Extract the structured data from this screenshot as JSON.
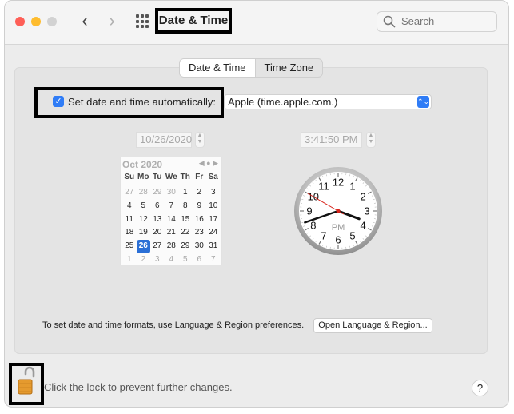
{
  "window": {
    "title": "Date & Time"
  },
  "toolbar": {
    "back": "‹",
    "forward": "›"
  },
  "search": {
    "placeholder": "Search"
  },
  "tabs": [
    {
      "label": "Date & Time",
      "active": true
    },
    {
      "label": "Time Zone",
      "active": false
    }
  ],
  "auto": {
    "label": "Set date and time automatically:",
    "checked": true
  },
  "server": {
    "value": "Apple (time.apple.com.)"
  },
  "date_field": {
    "value": "10/26/2020"
  },
  "time_field": {
    "value": "3:41:50 PM"
  },
  "calendar": {
    "month_label": "Oct 2020",
    "weekdays": [
      "Su",
      "Mo",
      "Tu",
      "We",
      "Th",
      "Fr",
      "Sa"
    ],
    "weeks": [
      [
        "27",
        "28",
        "29",
        "30",
        "1",
        "2",
        "3"
      ],
      [
        "4",
        "5",
        "6",
        "7",
        "8",
        "9",
        "10"
      ],
      [
        "11",
        "12",
        "13",
        "14",
        "15",
        "16",
        "17"
      ],
      [
        "18",
        "19",
        "20",
        "21",
        "22",
        "23",
        "24"
      ],
      [
        "25",
        "26",
        "27",
        "28",
        "29",
        "30",
        "31"
      ],
      [
        "1",
        "2",
        "3",
        "4",
        "5",
        "6",
        "7"
      ]
    ],
    "selected": "26"
  },
  "clock": {
    "numbers": [
      "12",
      "1",
      "2",
      "3",
      "4",
      "5",
      "6",
      "7",
      "8",
      "9",
      "10",
      "11"
    ],
    "meridiem": "PM",
    "hour": 3,
    "minute": 41,
    "second": 50
  },
  "formats": {
    "text": "To set date and time formats, use Language & Region preferences.",
    "button": "Open Language & Region..."
  },
  "lock": {
    "text": "Click the lock to prevent further changes."
  },
  "help": {
    "label": "?"
  },
  "colors": {
    "accent": "#2f7cf6",
    "selected_day": "#2a6fd6",
    "second_hand": "#d9241c"
  }
}
